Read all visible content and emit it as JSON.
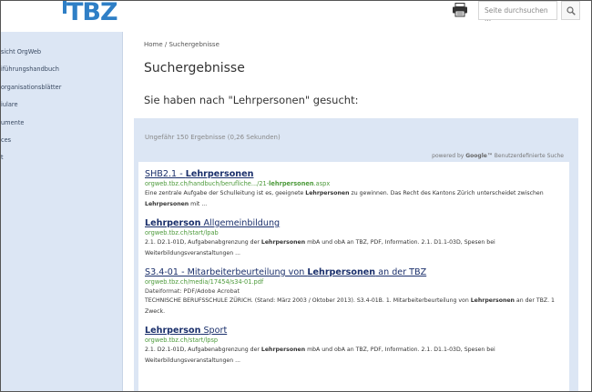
{
  "header": {
    "logo_text": "TBZ",
    "search_placeholder": "Seite durchsuchen ...",
    "icons": [
      "print-icon",
      "search-icon"
    ]
  },
  "sidebar": {
    "items": [
      {
        "label": "sicht OrgWeb"
      },
      {
        "label": "iführungshandbuch"
      },
      {
        "label": "organisationsblätter"
      },
      {
        "label": "iulare"
      },
      {
        "label": "umente"
      },
      {
        "label": "ces"
      },
      {
        "label": "t"
      }
    ]
  },
  "main": {
    "breadcrumb": "Home / Suchergebnisse",
    "title": "Suchergebnisse",
    "subtitle": "Sie haben nach \"Lehrpersonen\" gesucht:"
  },
  "results": {
    "count_text": "Ungefähr 150 Ergebnisse (0,26 Sekunden)",
    "powered_by": "powered by",
    "powered_brand": "Google™",
    "powered_suffix": "Benutzerdefinierte Suche",
    "items": [
      {
        "title_pre": "SHB2.1 - ",
        "title_bold": "Lehrpersonen",
        "title_post": "",
        "url_pre": "orgweb.tbz.ch/handbuch/berufliche.../21-",
        "url_bold": "lehrpersonen",
        "url_post": ".aspx",
        "meta": "",
        "snip1_pre": "Eine zentrale Aufgabe der Schulleitung ist es, geeignete ",
        "snip1_bold": "Lehrpersonen",
        "snip1_post": " zu gewinnen. Das Recht des Kantons Zürich unterscheidet zwischen",
        "snip2_pre": "",
        "snip2_bold": "Lehrpersonen",
        "snip2_post": " mit ..."
      },
      {
        "title_pre": "",
        "title_bold": "Lehrperson",
        "title_post": " Allgemeinbildung",
        "url_pre": "orgweb.tbz.ch/start/lpab",
        "url_bold": "",
        "url_post": "",
        "meta": "",
        "snip1_pre": "2.1. D2.1-01D, Aufgabenabgrenzung der ",
        "snip1_bold": "Lehrpersonen",
        "snip1_post": " mbA und obA an TBZ, PDF, Information. 2.1. D1.1-03D, Spesen bei",
        "snip2_pre": "Weiterbildungsveranstaltungen ...",
        "snip2_bold": "",
        "snip2_post": ""
      },
      {
        "title_pre": "S3.4-01 - Mitarbeiterbeurteilung von ",
        "title_bold": "Lehrpersonen",
        "title_post": " an der TBZ",
        "url_pre": "orgweb.tbz.ch/media/17454/s34-01.pdf",
        "url_bold": "",
        "url_post": "",
        "meta": "Dateiformat: PDF/Adobe Acrobat",
        "snip1_pre": "TECHNISCHE BERUFSSCHULE ZÜRICH. (Stand: März 2003 / Oktober 2013). S3.4-01B. 1. Mitarbeiterbeurteilung von ",
        "snip1_bold": "Lehrpersonen",
        "snip1_post": " an der TBZ. 1",
        "snip2_pre": "Zweck.",
        "snip2_bold": "",
        "snip2_post": ""
      },
      {
        "title_pre": "",
        "title_bold": "Lehrperson",
        "title_post": " Sport",
        "url_pre": "orgweb.tbz.ch/start/lpsp",
        "url_bold": "",
        "url_post": "",
        "meta": "",
        "snip1_pre": "2.1. D2.1-01D, Aufgabenabgrenzung der ",
        "snip1_bold": "Lehrpersonen",
        "snip1_post": " mbA und obA an TBZ, PDF, Information. 2.1. D1.1-03D, Spesen bei",
        "snip2_pre": "Weiterbildungsveranstaltungen ...",
        "snip2_bold": "",
        "snip2_post": ""
      }
    ]
  },
  "colors": {
    "accent_blue": "#1a2f6b",
    "url_green": "#4c9a3a",
    "panel_bg": "#dce6f4",
    "logo_blue": "#2f7fc6"
  }
}
